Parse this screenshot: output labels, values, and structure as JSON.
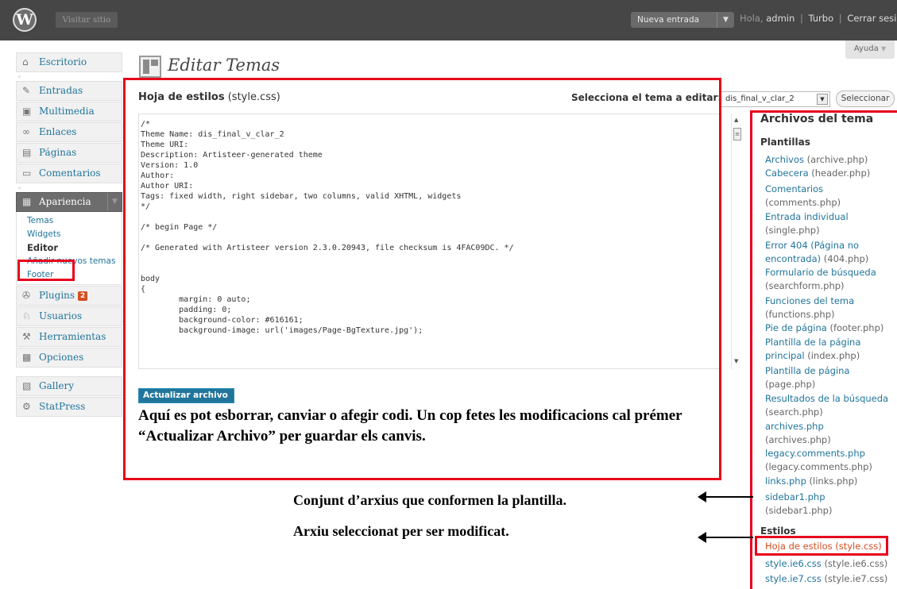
{
  "topbar": {
    "logo_glyph": "W",
    "visit_site": "Visitar sitio",
    "new_entry": "Nueva entrada",
    "new_entry_arrow": "▼",
    "greeting": "Hola,",
    "username": "admin",
    "turbo": "Turbo",
    "logout": "Cerrar sesión",
    "separator": "|"
  },
  "sidebar": {
    "dashboard": {
      "icon": "home-icon",
      "glyph": "⌂",
      "label": "Escritorio"
    },
    "items_top": [
      {
        "icon": "pin-icon",
        "glyph": "✎",
        "label": "Entradas"
      },
      {
        "icon": "media-icon",
        "glyph": "▣",
        "label": "Multimedia"
      },
      {
        "icon": "link-icon",
        "glyph": "∞",
        "label": "Enlaces"
      },
      {
        "icon": "pages-icon",
        "glyph": "▤",
        "label": "Páginas"
      },
      {
        "icon": "comments-icon",
        "glyph": "▭",
        "label": "Comentarios"
      }
    ],
    "appearance": {
      "icon": "appearance-icon",
      "glyph": "▦",
      "label": "Apariencia",
      "arrow": "▼"
    },
    "appearance_sub": [
      {
        "label": "Temas",
        "current": false
      },
      {
        "label": "Widgets",
        "current": false
      },
      {
        "label": "Editor",
        "current": true
      },
      {
        "label": "Añadir nuevos temas",
        "current": false
      },
      {
        "label": "Footer",
        "current": false
      }
    ],
    "items_bottom": [
      {
        "icon": "plugins-icon",
        "glyph": "✇",
        "label": "Plugins",
        "badge": "2"
      },
      {
        "icon": "users-icon",
        "glyph": "♘",
        "label": "Usuarios",
        "badge": ""
      },
      {
        "icon": "tools-icon",
        "glyph": "⚒",
        "label": "Herramientas",
        "badge": ""
      },
      {
        "icon": "settings-icon",
        "glyph": "▩",
        "label": "Opciones",
        "badge": ""
      }
    ],
    "items_extra": [
      {
        "icon": "gallery-icon",
        "glyph": "▧",
        "label": "Gallery"
      },
      {
        "icon": "statpress-icon",
        "glyph": "⚙",
        "label": "StatPress"
      }
    ],
    "gap_dot": "«"
  },
  "header": {
    "title": "Editar Temas",
    "help": "Ayuda",
    "help_arrow": "▼"
  },
  "editor": {
    "file_title_strong": "Hoja de estilos",
    "file_title_name": "(style.css)",
    "theme_select_label": "Selecciona el tema a editar:",
    "theme_selected": "dis_final_v_clar_2",
    "select_arrow": "▼",
    "select_button": "Seleccionar",
    "code_lines": [
      "/*",
      "Theme Name: dis_final_v_clar_2",
      "Theme URI:",
      "Description: Artisteer-generated theme",
      "Version: 1.0",
      "Author:",
      "Author URI:",
      "Tags: fixed width, right sidebar, two columns, valid XHTML, widgets",
      "*/",
      "",
      "/* begin Page */",
      "",
      "/* Generated with Artisteer version 2.3.0.20943, file checksum is 4FAC09DC. */",
      "",
      "",
      "body",
      "{",
      "        margin: 0 auto;",
      "        padding: 0;",
      "        background-color: #616161;",
      "        background-image: url('images/Page-BgTexture.jpg');"
    ],
    "scroll_up": "▲",
    "scroll_thumb": "≡",
    "scroll_down": "▼",
    "update_button": "Actualizar archivo"
  },
  "files": {
    "title": "Archivos del tema",
    "templates_heading": "Plantillas",
    "templates": [
      {
        "link": "Archivos",
        "file": "(archive.php)"
      },
      {
        "link": "Cabecera",
        "file": "(header.php)"
      },
      {
        "link": "Comentarios",
        "file": "(comments.php)"
      },
      {
        "link": "Entrada individual",
        "file": "(single.php)"
      },
      {
        "link": "Error 404 (Página no encontrada)",
        "file": "(404.php)"
      },
      {
        "link": "Formulario de búsqueda",
        "file": "(searchform.php)"
      },
      {
        "link": "Funciones del tema",
        "file": "(functions.php)"
      },
      {
        "link": "Pie de página",
        "file": "(footer.php)"
      },
      {
        "link": "Plantilla de la página principal",
        "file": "(index.php)"
      },
      {
        "link": "Plantilla de página",
        "file": "(page.php)"
      },
      {
        "link": "Resultados de la búsqueda",
        "file": "(search.php)"
      },
      {
        "link": "archives.php",
        "file": "(archives.php)"
      },
      {
        "link": "legacy.comments.php",
        "file": "(legacy.comments.php)"
      },
      {
        "link": "links.php",
        "file": "(links.php)"
      },
      {
        "link": "sidebar1.php",
        "file": "(sidebar1.php)"
      }
    ],
    "styles_heading": "Estilos",
    "styles": [
      {
        "link": "Hoja de estilos",
        "file": "(style.css)"
      },
      {
        "link": "style.ie6.css",
        "file": "(style.ie6.css)"
      },
      {
        "link": "style.ie7.css",
        "file": "(style.ie7.css)"
      }
    ]
  },
  "annotations": {
    "editor_note": "Aquí es pot esborrar, canviar o afegir codi. Un cop fetes les modificacions cal prémer “Actualizar Archivo” per guardar els canvis.",
    "files_note": "Conjunt d’arxius que conformen la plantilla.",
    "selected_note": "Arxiu seleccionat per ser modificat."
  },
  "colors": {
    "topbar": "#464646",
    "link": "#21759b",
    "annotation_red": "#e8001c",
    "update_badge": "#d54e21"
  }
}
